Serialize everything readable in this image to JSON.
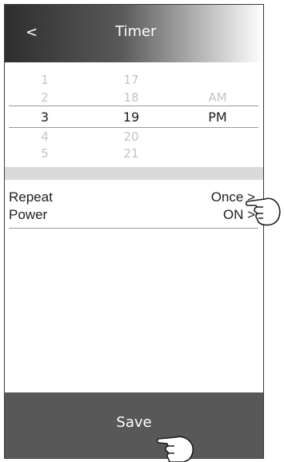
{
  "header": {
    "back_label": "<",
    "title": "Timer"
  },
  "picker": {
    "rows": [
      {
        "hour": "1",
        "minute": "17",
        "period": ""
      },
      {
        "hour": "2",
        "minute": "18",
        "period": "AM"
      },
      {
        "hour": "3",
        "minute": "19",
        "period": "PM"
      },
      {
        "hour": "4",
        "minute": "20",
        "period": ""
      },
      {
        "hour": "5",
        "minute": "21",
        "period": ""
      }
    ],
    "selected_index": 2
  },
  "settings": {
    "repeat": {
      "label": "Repeat",
      "value": "Once >"
    },
    "power": {
      "label": "Power",
      "value": "ON >"
    }
  },
  "footer": {
    "save_label": "Save"
  },
  "icons": {
    "pointer_hand": "pointing-hand-icon"
  }
}
